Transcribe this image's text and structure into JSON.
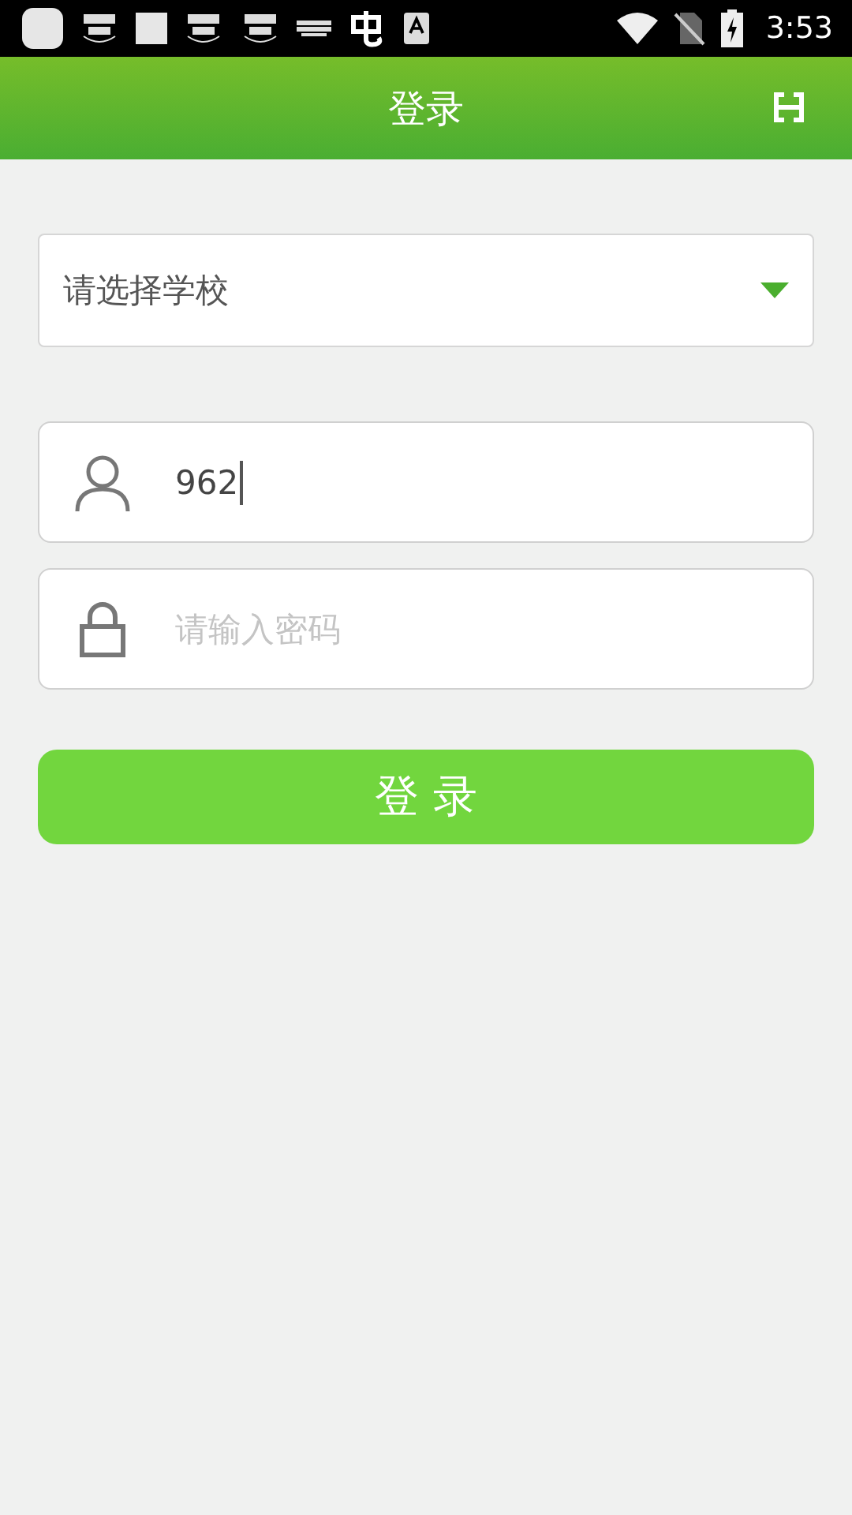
{
  "status_bar": {
    "time": "3:53"
  },
  "header": {
    "title": "登录"
  },
  "school_select": {
    "placeholder": "请选择学校"
  },
  "username": {
    "value": "962",
    "focused": true
  },
  "password": {
    "placeholder": "请输入密码"
  },
  "login_button": {
    "label": "登 录"
  }
}
